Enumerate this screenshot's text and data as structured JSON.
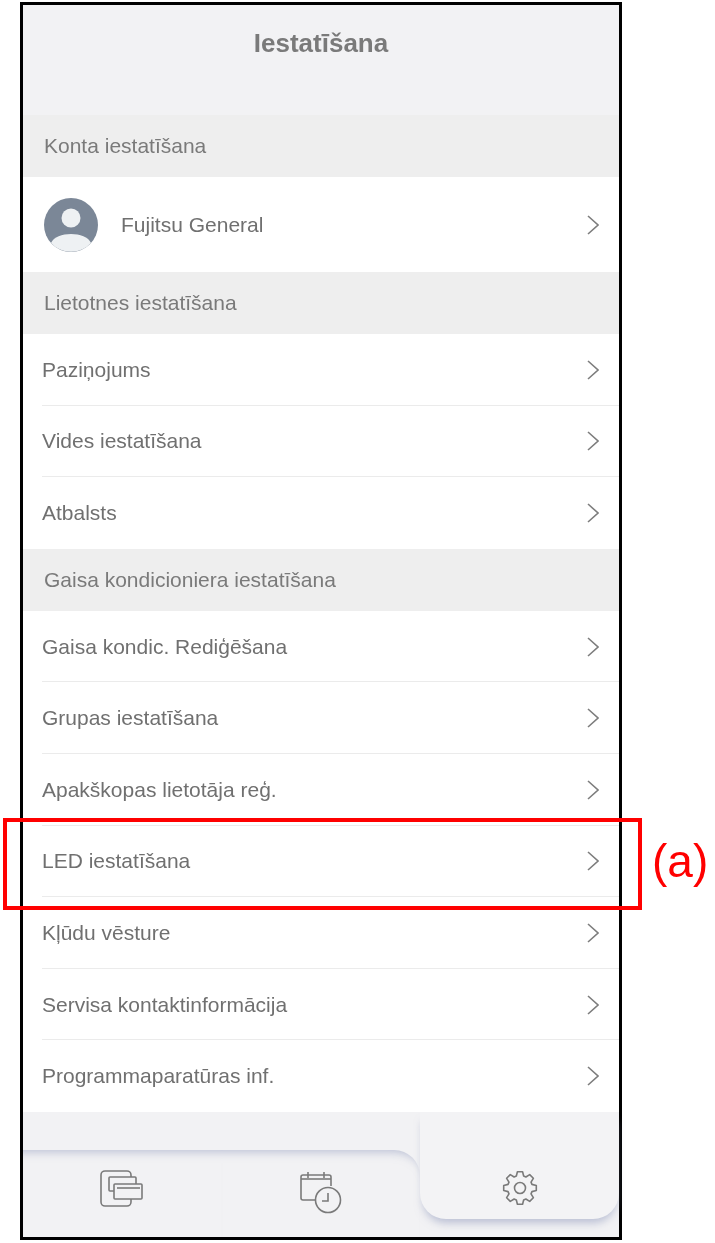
{
  "header": {
    "title": "Iestatīšana"
  },
  "sections": [
    {
      "title": "Konta iestatīšana",
      "items": [
        {
          "kind": "account",
          "label": "Fujitsu General",
          "highlighted": false
        }
      ]
    },
    {
      "title": "Lietotnes iestatīšana",
      "items": [
        {
          "kind": "link",
          "label": "Paziņojums",
          "highlighted": false
        },
        {
          "kind": "link",
          "label": "Vides iestatīšana",
          "highlighted": false
        },
        {
          "kind": "link",
          "label": "Atbalsts",
          "highlighted": false
        }
      ]
    },
    {
      "title": "Gaisa kondicioniera iestatīšana",
      "items": [
        {
          "kind": "link",
          "label": "Gaisa kondic. Rediģēšana",
          "highlighted": false
        },
        {
          "kind": "link",
          "label": "Grupas iestatīšana",
          "highlighted": false
        },
        {
          "kind": "link",
          "label": "Apakškopas lietotāja reģ.",
          "highlighted": false
        },
        {
          "kind": "link",
          "label": "LED iestatīšana",
          "highlighted": true
        },
        {
          "kind": "link",
          "label": "Kļūdu vēsture",
          "highlighted": false
        },
        {
          "kind": "link",
          "label": "Servisa kontaktinformācija",
          "highlighted": false
        },
        {
          "kind": "link",
          "label": "Programmaparatūras inf.",
          "highlighted": false
        }
      ]
    }
  ],
  "annotation": {
    "label": "(a)"
  },
  "tab_bar": {
    "tabs": [
      {
        "kind": "devices",
        "selected": false
      },
      {
        "kind": "schedule",
        "selected": false
      },
      {
        "kind": "settings",
        "selected": true
      }
    ]
  }
}
